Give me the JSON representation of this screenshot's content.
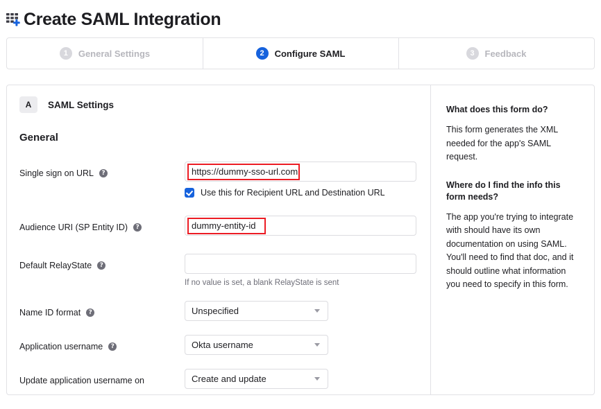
{
  "header": {
    "icon": "app-grid-plus-icon",
    "title": "Create SAML Integration"
  },
  "stepper": {
    "steps": [
      {
        "num": "1",
        "label": "General Settings",
        "active": false
      },
      {
        "num": "2",
        "label": "Configure SAML",
        "active": true
      },
      {
        "num": "3",
        "label": "Feedback",
        "active": false
      }
    ]
  },
  "section": {
    "badge": "A",
    "title": "SAML Settings",
    "group_title": "General"
  },
  "fields": {
    "sso_url": {
      "label": "Single sign on URL",
      "help_icon": "help-circle-icon",
      "value": "https://dummy-sso-url.com",
      "checkbox_label": "Use this for Recipient URL and Destination URL",
      "checkbox_checked": "true"
    },
    "audience_uri": {
      "label": "Audience URI (SP Entity ID)",
      "help_icon": "help-circle-icon",
      "value": "dummy-entity-id"
    },
    "default_relaystate": {
      "label": "Default RelayState",
      "help_icon": "help-circle-icon",
      "value": "",
      "hint": "If no value is set, a blank RelayState is sent"
    },
    "name_id_format": {
      "label": "Name ID format",
      "help_icon": "help-circle-icon",
      "value": "Unspecified"
    },
    "application_username": {
      "label": "Application username",
      "help_icon": "help-circle-icon",
      "value": "Okta username"
    },
    "update_username_on": {
      "label": "Update application username on",
      "value": "Create and update"
    }
  },
  "side_panel": {
    "q1_heading": "What does this form do?",
    "q1_body": "This form generates the XML needed for the app's SAML request.",
    "q2_heading": "Where do I find the info this form needs?",
    "q2_body": "The app you're trying to integrate with should have its own documentation on using SAML. You'll need to find that doc, and it should outline what information you need to specify in this form."
  },
  "colors": {
    "accent_blue": "#1662dd",
    "annotation_red": "#ec1c24",
    "border_gray": "#e1e1e5",
    "muted_text": "#6e6e78"
  }
}
